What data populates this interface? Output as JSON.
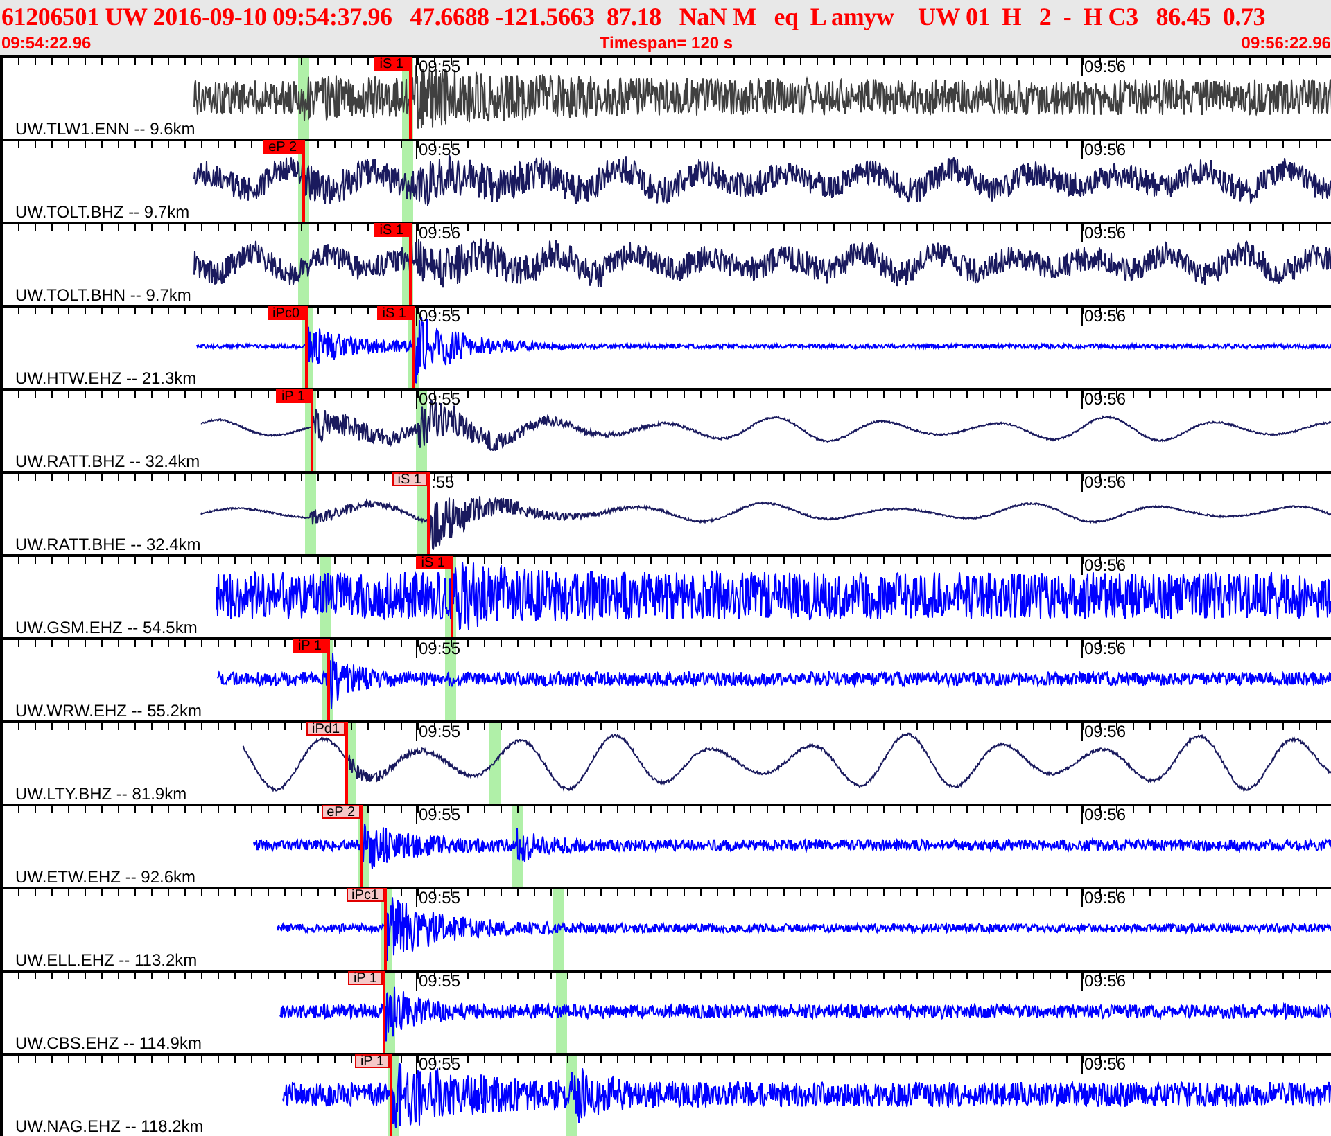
{
  "header": {
    "title": "61206501 UW 2016-09-10 09:54:37.96   47.6688 -121.5663  87.18   NaN M   eq  L amyw    UW 01  H   2  -  H C3   86.45  0.73",
    "start_time": "09:54:22.96",
    "timespan": "Timespan= 120 s",
    "end_time": "09:56:22.96"
  },
  "traces": [
    {
      "label": "UW.TLW1.ENN -- 9.6km",
      "color": "#404040",
      "time_labels": [
        "09:55",
        "09:56"
      ],
      "picks": [
        {
          "label": "iS 1",
          "filled": true
        }
      ]
    },
    {
      "label": "UW.TOLT.BHZ -- 9.7km",
      "color": "#1a1a5e",
      "time_labels": [
        "09:55",
        "09:56"
      ],
      "picks": [
        {
          "label": "eP 2",
          "filled": true
        }
      ]
    },
    {
      "label": "UW.TOLT.BHN -- 9.7km",
      "color": "#1a1a5e",
      "time_labels": [
        "09:56",
        "09:56"
      ],
      "picks": [
        {
          "label": "iS 1",
          "filled": true
        }
      ]
    },
    {
      "label": "UW.HTW.EHZ -- 21.3km",
      "color": "#0000ff",
      "time_labels": [
        "09:55",
        "09:56"
      ],
      "picks": [
        {
          "label": "iPc0",
          "filled": true
        },
        {
          "label": "iS 1",
          "filled": true
        }
      ]
    },
    {
      "label": "UW.RATT.BHZ -- 32.4km",
      "color": "#1a1a5e",
      "time_labels": [
        "09:55",
        "09:56"
      ],
      "picks": [
        {
          "label": "iP 1",
          "filled": true
        }
      ]
    },
    {
      "label": "UW.RATT.BHE -- 32.4km",
      "color": "#1a1a5e",
      "time_labels": [
        ":55",
        "09:56"
      ],
      "picks": [
        {
          "label": "iS 1",
          "filled": false
        }
      ]
    },
    {
      "label": "UW.GSM.EHZ -- 54.5km",
      "color": "#0000ff",
      "time_labels": [
        "09:56"
      ],
      "picks": [
        {
          "label": "iS 1",
          "filled": true
        }
      ]
    },
    {
      "label": "UW.WRW.EHZ -- 55.2km",
      "color": "#0000ff",
      "time_labels": [
        "09:55",
        "09:56"
      ],
      "picks": [
        {
          "label": "iP 1",
          "filled": true
        }
      ]
    },
    {
      "label": "UW.LTY.BHZ -- 81.9km",
      "color": "#1a1a5e",
      "time_labels": [
        "09:55",
        "09:56"
      ],
      "picks": [
        {
          "label": "iPd1",
          "filled": false
        }
      ]
    },
    {
      "label": "UW.ETW.EHZ -- 92.6km",
      "color": "#0000ff",
      "time_labels": [
        "09:55",
        "09:56"
      ],
      "picks": [
        {
          "label": "eP 2",
          "filled": false
        }
      ]
    },
    {
      "label": "UW.ELL.EHZ -- 113.2km",
      "color": "#0000ff",
      "time_labels": [
        "09:55",
        "09:56"
      ],
      "picks": [
        {
          "label": "iPc1",
          "filled": false
        }
      ]
    },
    {
      "label": "UW.CBS.EHZ -- 114.9km",
      "color": "#0000ff",
      "time_labels": [
        "09:55",
        "09:56"
      ],
      "picks": [
        {
          "label": "iP 1",
          "filled": false
        }
      ]
    },
    {
      "label": "UW.NAG.EHZ -- 118.2km",
      "color": "#0000ff",
      "time_labels": [
        "09:55",
        "09:56"
      ],
      "picks": [
        {
          "label": "iP 1",
          "filled": false
        }
      ]
    }
  ]
}
